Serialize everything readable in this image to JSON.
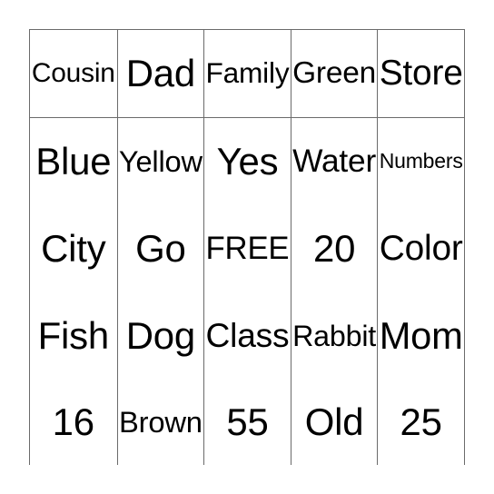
{
  "card": {
    "type": "bingo-card",
    "columns": 5,
    "rows": 5,
    "free_space": "FREE",
    "colors": {
      "background": "#ffffff",
      "grid_line": "#6b6b6b",
      "text": "#000000"
    },
    "cells": [
      [
        {
          "text": "Cousin"
        },
        {
          "text": "Dad"
        },
        {
          "text": "Family"
        },
        {
          "text": "Green"
        },
        {
          "text": "Store"
        }
      ],
      [
        {
          "text": "Blue"
        },
        {
          "text": "Yellow"
        },
        {
          "text": "Yes"
        },
        {
          "text": "Water"
        },
        {
          "text": "Numbers"
        }
      ],
      [
        {
          "text": "City"
        },
        {
          "text": "Go"
        },
        {
          "text": "FREE"
        },
        {
          "text": "20"
        },
        {
          "text": "Color"
        }
      ],
      [
        {
          "text": "Fish"
        },
        {
          "text": "Dog"
        },
        {
          "text": "Class"
        },
        {
          "text": "Rabbit"
        },
        {
          "text": "Mom"
        }
      ],
      [
        {
          "text": "16"
        },
        {
          "text": "Brown"
        },
        {
          "text": "55"
        },
        {
          "text": "Old"
        },
        {
          "text": "25"
        }
      ]
    ]
  }
}
